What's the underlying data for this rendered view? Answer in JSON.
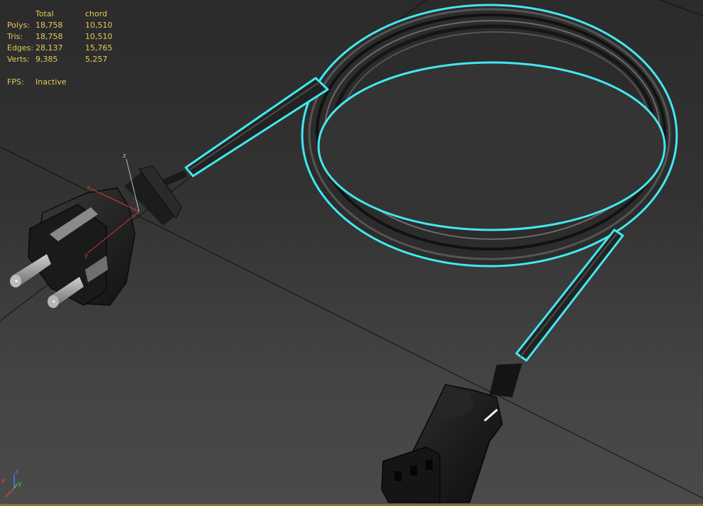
{
  "stats": {
    "header": {
      "total": "Total",
      "object": "chord"
    },
    "rows": [
      {
        "label": "Polys:",
        "total": "18,758",
        "object": "10,510"
      },
      {
        "label": "Tris:",
        "total": "18,758",
        "object": "10,510"
      },
      {
        "label": "Edges:",
        "total": "28,137",
        "object": "15,765"
      },
      {
        "label": "Verts:",
        "total": "9,385",
        "object": "5,257"
      }
    ],
    "fps": {
      "label": "FPS:",
      "value": "Inactive"
    }
  },
  "gizmo": {
    "x": "x",
    "y": "y",
    "z": "z"
  },
  "triad": {
    "x": "x",
    "y": "y",
    "z": "z"
  },
  "colors": {
    "stats_text": "#e6c85a",
    "selection_outline": "#43e8f0",
    "gizmo_x": "#d23a2a",
    "gizmo_z": "#bdbdbd",
    "triad_x": "#e0453a",
    "triad_y": "#3ccf4a",
    "triad_z": "#4a7df0"
  }
}
